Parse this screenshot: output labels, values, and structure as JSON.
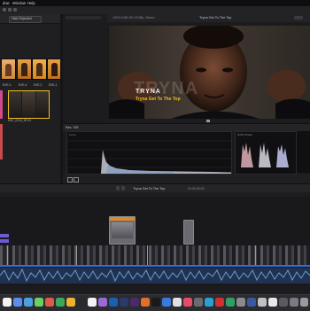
{
  "menubar": {
    "items": [
      "dow",
      "Window",
      "Help"
    ]
  },
  "browser": {
    "filter_label": "Hide Rejected",
    "clips": [
      {
        "label": "EVE-3",
        "color": "#d08a2c"
      },
      {
        "label": "EVE-4",
        "color": "#b86a20"
      },
      {
        "label": "EVE-2",
        "color": "#e08a18"
      },
      {
        "label": "EVE-1",
        "color": "#c06a1a"
      }
    ],
    "selected_clip_label": "DSC_0216_1R-01"
  },
  "viewer": {
    "format_label": "1920×1080 HD 23.98p, Stereo",
    "title": "Tryna Get To The Top",
    "overlay_title": "TRYNA",
    "overlay_subtitle": "Tryna Get To The Top",
    "bg_word": "TRYNA"
  },
  "scopes": {
    "label": "Rec. 709",
    "waveform_label": "Luma",
    "parade_label": "RGB Parade"
  },
  "timeline": {
    "title": "Tryna Get To The Top",
    "timecode": "00:00:04:09"
  },
  "colors": {
    "accent": "#2f6fdf",
    "audio": "#3f5f8f",
    "orange_clip": "#d98a2a"
  }
}
